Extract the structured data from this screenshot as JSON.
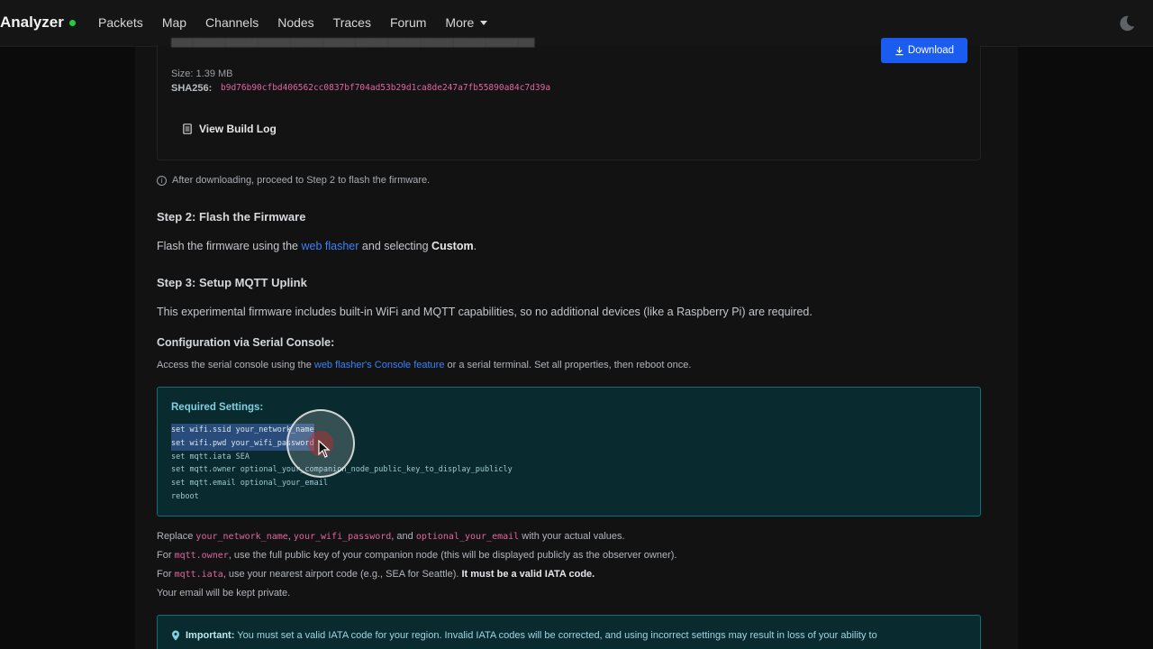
{
  "navbar": {
    "brand": "Analyzer",
    "links": [
      "Packets",
      "Map",
      "Channels",
      "Nodes",
      "Traces",
      "Forum"
    ],
    "more_label": "More",
    "theme_icon": "moon-icon",
    "status_color": "#27c93f"
  },
  "build": {
    "size_label": "Size:",
    "size_value": "1.39 MB",
    "sha_label": "SHA256:",
    "sha_value": "b9d76b90cfbd406562cc0837bf704ad53b29d1ca8de247a7fb55890a84c7d39a",
    "download_label": "Download",
    "build_log_label": "View Build Log"
  },
  "info_note": "After downloading, proceed to Step 2 to flash the firmware.",
  "step2": {
    "heading": "Step 2: Flash the Firmware",
    "text_before": "Flash the firmware using the ",
    "link": "web flasher",
    "text_middle": " and selecting ",
    "strong": "Custom",
    "text_after": "."
  },
  "step3": {
    "heading": "Step 3: Setup MQTT Uplink",
    "text": "This experimental firmware includes built-in WiFi and MQTT capabilities, so no additional devices (like a Raspberry Pi) are required."
  },
  "config": {
    "heading": "Configuration via Serial Console:",
    "text_before": "Access the serial console using the ",
    "link": "web flasher's Console feature",
    "text_after": " or a serial terminal. Set all properties, then reboot once."
  },
  "required": {
    "title": "Required Settings:",
    "lines": [
      "set wifi.ssid your_network_name",
      "set wifi.pwd your_wifi_password",
      "set mqtt.iata SEA",
      "set mqtt.owner optional_your_companion_node_public_key_to_display_publicly",
      "set mqtt.email optional_your_email",
      "reboot"
    ]
  },
  "notes": {
    "line1_a": "Replace ",
    "line1_c1": "your_network_name",
    "line1_b": ", ",
    "line1_c2": "your_wifi_password",
    "line1_c": ", and ",
    "line1_c3": "optional_your_email",
    "line1_d": " with your actual values.",
    "line2_a": "For ",
    "line2_code": "mqtt.owner",
    "line2_b": ", use the full public key of your companion node (this will be displayed publicly as the observer owner).",
    "line3_a": "For ",
    "line3_code": "mqtt.iata",
    "line3_b": ", use your nearest airport code (e.g., SEA for Seattle). ",
    "line3_strong": "It must be a valid IATA code.",
    "line4": "Your email will be kept private."
  },
  "important": {
    "label": "Important:",
    "text": " You must set a valid IATA code for your region. Invalid IATA codes will be corrected, and using incorrect settings may result in loss of your ability to"
  }
}
